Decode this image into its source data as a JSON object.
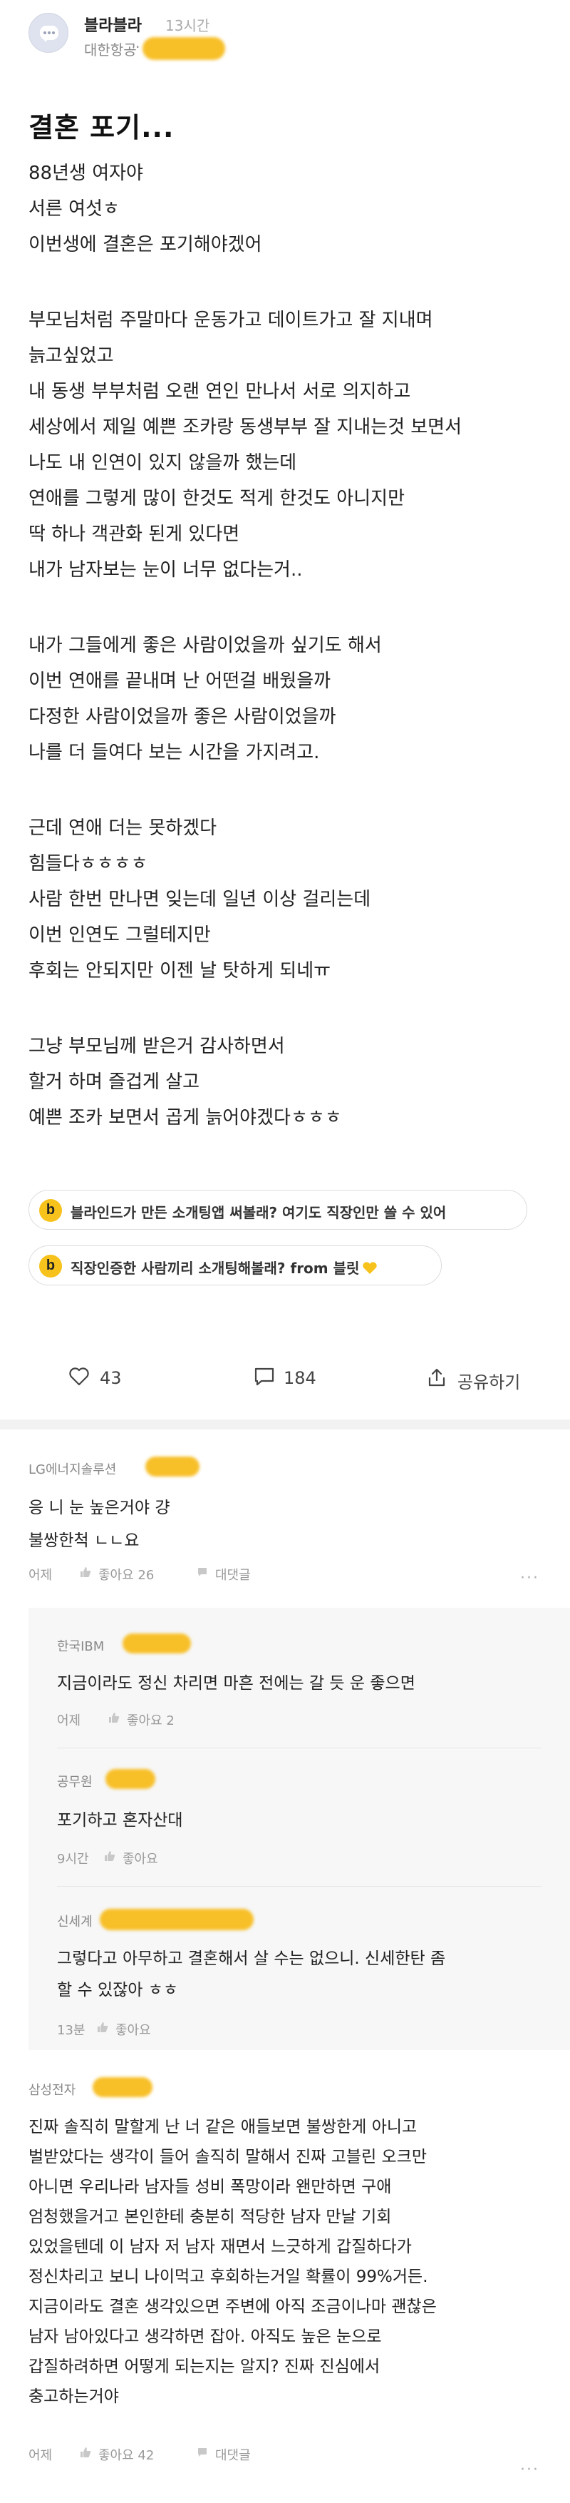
{
  "post": {
    "author": "블라블라",
    "time": "13시간",
    "company": "대한항공",
    "company_dot": "·",
    "title": "결혼 포기...",
    "lines": [
      "88년생 여자야",
      "서른 여섯ㅎ",
      "이번생에 결혼은 포기해야겠어",
      "부모님처럼 주말마다 운동가고 데이트가고 잘 지내며",
      "늙고싶었고",
      "내 동생 부부처럼 오랜 연인 만나서 서로 의지하고",
      "세상에서 제일 예쁜 조카랑 동생부부 잘 지내는것 보면서",
      "나도 내 인연이 있지 않을까 했는데",
      "연애를 그렇게 많이 한것도 적게 한것도 아니지만",
      "딱 하나 객관화 된게 있다면",
      "내가 남자보는 눈이 너무 없다는거..",
      "내가 그들에게 좋은 사람이었을까 싶기도 해서",
      "이번 연애를 끝내며 난 어떤걸 배웠을까",
      "다정한 사람이었을까 좋은 사람이었을까",
      "나를 더 들여다 보는 시간을 가지려고.",
      "근데 연애 더는 못하겠다",
      "힘들다ㅎㅎㅎㅎ",
      "사람 한번 만나면 잊는데 일년 이상 걸리는데",
      "이번 인연도 그럴테지만",
      "후회는 안되지만 이젠 날 탓하게 되네ㅠ",
      "그냥 부모님께 받은거 감사하면서",
      "할거 하며 즐겁게 살고",
      "예쁜 조카 보면서 곱게 늙어야겠다ㅎㅎㅎ"
    ],
    "likes": "43",
    "comments": "184",
    "share_label": "공유하기"
  },
  "ads": [
    {
      "icon": "b",
      "text": "블라인드가 만든 소개팅앱 써볼래? 여기도 직장인만 쓸 수 있어"
    },
    {
      "icon": "b",
      "text": "직장인증한 사람끼리 소개팅해볼래? from 블릿"
    }
  ],
  "comments": [
    {
      "company": "LG에너지솔루션",
      "lines": [
        "응 니 눈 높은거야 걍",
        "불쌍한척 ㄴㄴ요"
      ],
      "time": "어제",
      "like_label": "좋아요 26",
      "reply_label": "대댓글",
      "more": "···"
    },
    {
      "company": "한국IBM",
      "lines": [
        "지금이라도 정신 차리면 마흔 전에는 갈 듯 운 좋으면"
      ],
      "time": "어제",
      "like_label": "좋아요 2"
    },
    {
      "company": "공무원",
      "lines": [
        "포기하고 혼자산대"
      ],
      "time": "9시간",
      "like_label": "좋아요"
    },
    {
      "company": "신세계",
      "lines": [
        "그렇다고 아무하고 결혼해서 살 수는 없으니. 신세한탄 좀",
        "할 수 있잖아 ㅎㅎ"
      ],
      "time": "13분",
      "like_label": "좋아요"
    },
    {
      "company": "삼성전자",
      "lines": [
        "진짜 솔직히 말할게 난 너 같은 애들보면 불쌍한게 아니고",
        "벌받았다는 생각이 들어 솔직히 말해서 진짜 고블린 오크만",
        "아니면 우리나라 남자들 성비 폭망이라 왠만하면 구애",
        "엄청했을거고 본인한테 충분히 적당한 남자 만날 기회",
        "있었을텐데 이 남자 저 남자 재면서 느긋하게 갑질하다가",
        "정신차리고 보니 나이먹고 후회하는거일 확률이 99%거든.",
        "지금이라도 결혼 생각있으면 주변에 아직 조금이나마 괜찮은",
        "남자 남아있다고 생각하면 잡아. 아직도 높은 눈으로",
        "갑질하려하면 어떻게 되는지는 알지? 진짜 진심에서",
        "충고하는거야"
      ],
      "time": "어제",
      "like_label": "좋아요 42",
      "reply_label": "대댓글",
      "more": "···"
    }
  ],
  "colors": {
    "accent_yellow": "#f7c21b",
    "blur_yellow": "#f7bf28"
  }
}
